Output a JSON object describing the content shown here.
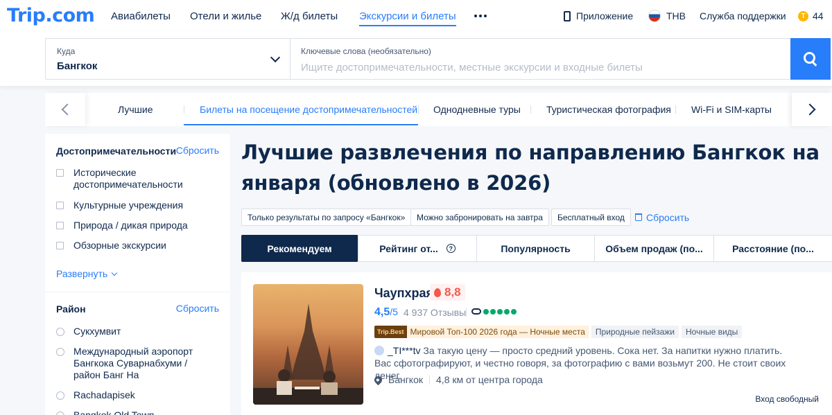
{
  "header": {
    "logo": "Trip.com",
    "nav": [
      {
        "label": "Авиабилеты"
      },
      {
        "label": "Отели и жилье"
      },
      {
        "label": "Ж/д билеты"
      },
      {
        "label": "Экскурсии и билеты",
        "active": true
      }
    ],
    "app_label": "Приложение",
    "currency": "THB",
    "support": "Служба поддержки",
    "points": "44"
  },
  "search": {
    "dest_label": "Куда",
    "dest_value": "Бангкок",
    "kw_label": "Ключевые слова (необязательно)",
    "kw_placeholder": "Ищите достопримечательности, местные экскурсии и входные билеты"
  },
  "categories": [
    {
      "label": "Лучшие"
    },
    {
      "label": "Билеты на посещение достопримечательностей",
      "active": true
    },
    {
      "label": "Однодневные туры"
    },
    {
      "label": "Туристическая фотография"
    },
    {
      "label": "Wi-Fi и SIM-карты"
    }
  ],
  "sidebar": {
    "attractions": {
      "title": "Достопримечательности",
      "reset": "Сбросить",
      "items": [
        {
          "label": "Исторические достопримечательности"
        },
        {
          "label": "Культурные учреждения"
        },
        {
          "label": "Природа / дикая природа"
        },
        {
          "label": "Обзорные экскурсии"
        }
      ],
      "expand": "Развернуть"
    },
    "district": {
      "title": "Район",
      "reset": "Сбросить",
      "items": [
        {
          "label": "Сукхумвит"
        },
        {
          "label": "Международный аэропорт Бангкока Суварнабхуми / район Банг На"
        },
        {
          "label": "Rachadapisek"
        },
        {
          "label": "Bangkok Old Town"
        }
      ]
    }
  },
  "main": {
    "title": "Лучшие развлечения по направлению Бангкок на января (обновлено в 2026)",
    "chips": [
      {
        "label": "Только результаты по запросу «Бангкок»"
      },
      {
        "label": "Можно забронировать на завтра"
      },
      {
        "label": "Бесплатный вход"
      }
    ],
    "chips_reset": "Сбросить",
    "sort": [
      {
        "label": "Рекомендуем",
        "active": true
      },
      {
        "label": "Рейтинг от..."
      },
      {
        "label": "Популярность"
      },
      {
        "label": "Объем продаж (по..."
      },
      {
        "label": "Расстояние (по..."
      }
    ],
    "sort_help": "?"
  },
  "card": {
    "title": "Чаупхрая",
    "hot_score": "8,8",
    "rating": "4,5",
    "rating_of": "/5",
    "reviews": "4 937 Отзывы",
    "tripadvisor_dots": 5,
    "trip_best_badge": "Trip.Best",
    "trip_best_text": "Мировой Топ-100 2026 года — Ночные места",
    "tags": [
      "Природные пейзажи",
      "Ночные виды"
    ],
    "review_user": "_TI***tv",
    "review_text": "За такую цену — просто средний уровень. Сока нет. За напитки нужно платить. Вас сфотографируют, и честно говоря, за фотографию с вами возьмут 200. Не стоит своих денег.",
    "location": "Бангкок",
    "distance": "4,8 км от центра города",
    "entry": "Вход свободный"
  },
  "colors": {
    "brand": "#287dfa",
    "navy": "#0f294d",
    "hot": "#f5594a",
    "tripadvisor": "#00aa6c"
  }
}
